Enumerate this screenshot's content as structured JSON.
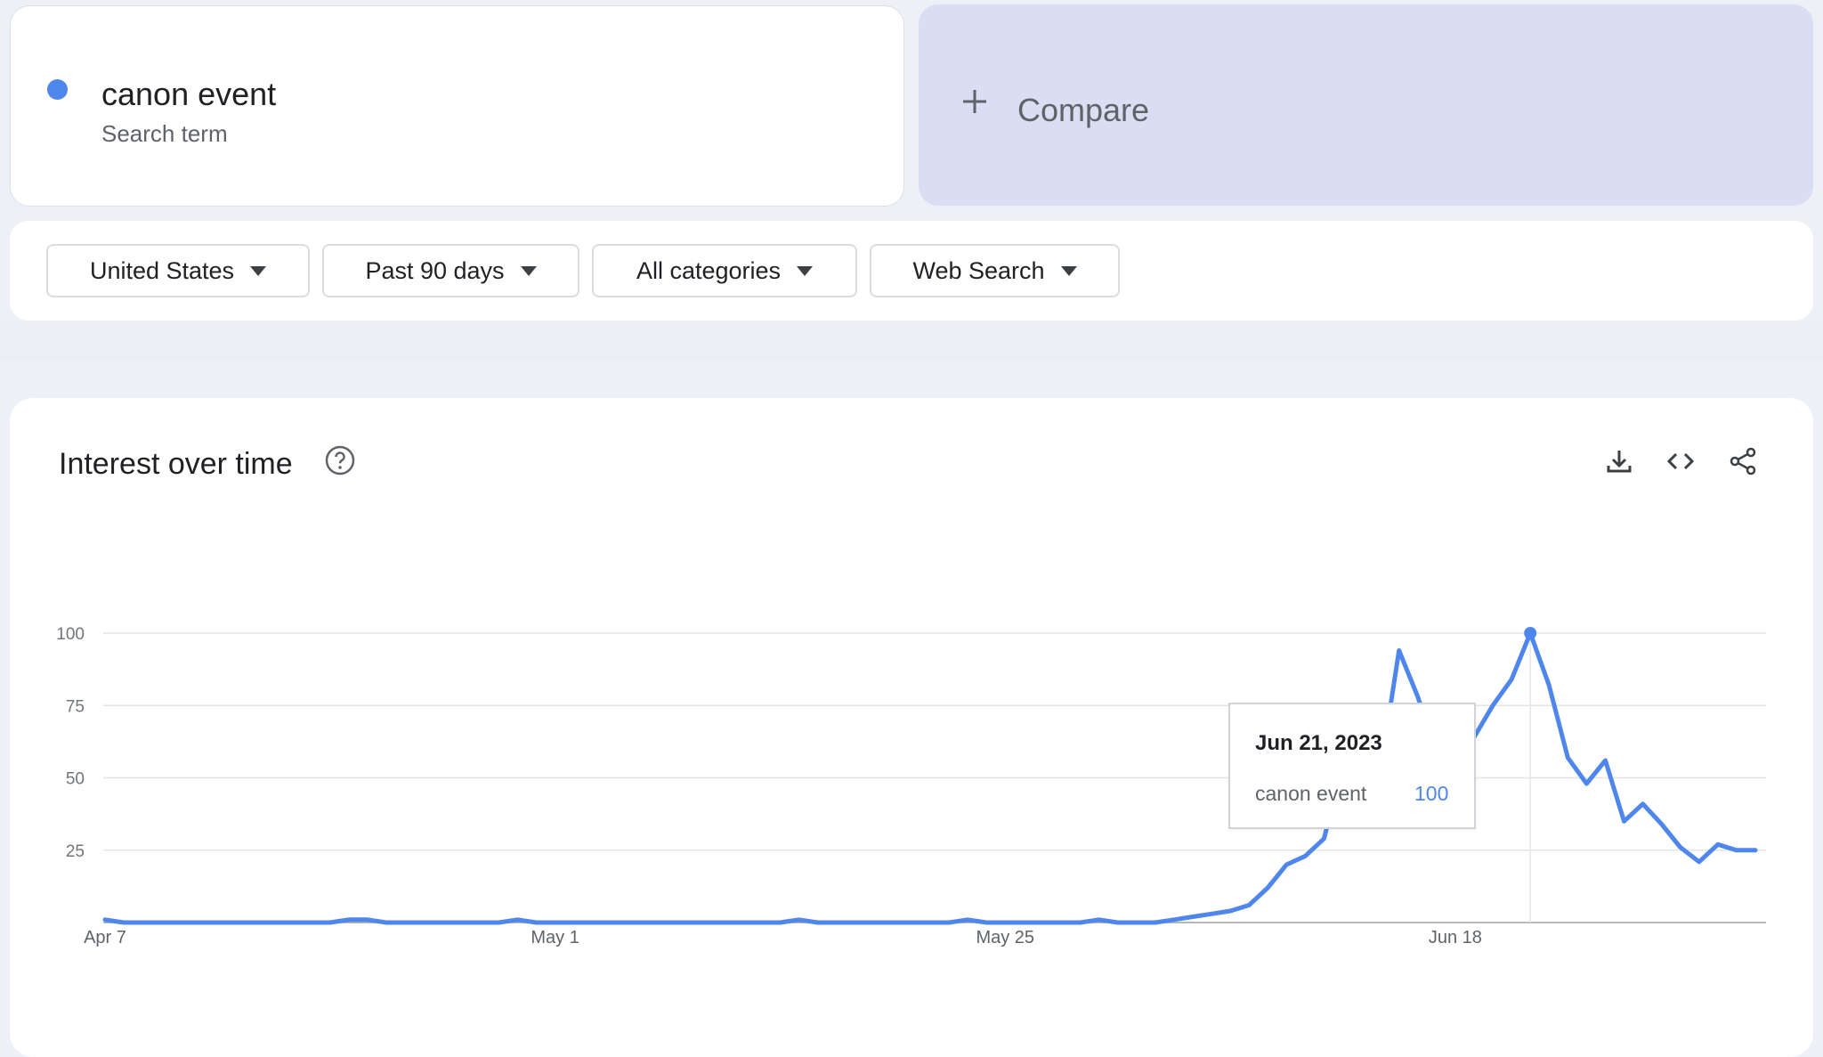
{
  "search_term": {
    "name": "canon event",
    "subtitle": "Search term",
    "color": "#4f86ec"
  },
  "compare": {
    "label": "Compare",
    "icon": "plus-icon"
  },
  "filters": [
    {
      "label": "United States",
      "icon": "caret-down-icon"
    },
    {
      "label": "Past 90 days",
      "icon": "caret-down-icon"
    },
    {
      "label": "All categories",
      "icon": "caret-down-icon"
    },
    {
      "label": "Web Search",
      "icon": "caret-down-icon"
    }
  ],
  "panel": {
    "title": "Interest over time",
    "help_icon": "help-icon",
    "tools": [
      "download-icon",
      "embed-code-icon",
      "share-icon"
    ]
  },
  "tooltip": {
    "date": "Jun 21, 2023",
    "series": "canon event",
    "value": "100"
  },
  "chart_data": {
    "type": "line",
    "x_ticks": [
      "Apr 7",
      "May 1",
      "May 25",
      "Jun 18"
    ],
    "y_ticks": [
      25,
      50,
      75,
      100
    ],
    "ylim": [
      0,
      100
    ],
    "grid": true,
    "series": [
      {
        "name": "canon event",
        "color": "#4f86ec",
        "start_date": "Apr 7",
        "values": [
          1,
          0,
          0,
          0,
          0,
          0,
          0,
          0,
          0,
          0,
          0,
          0,
          0,
          1,
          1,
          0,
          0,
          0,
          0,
          0,
          0,
          0,
          1,
          0,
          0,
          0,
          0,
          0,
          0,
          0,
          0,
          0,
          0,
          0,
          0,
          0,
          0,
          1,
          0,
          0,
          0,
          0,
          0,
          0,
          0,
          0,
          1,
          0,
          0,
          0,
          0,
          0,
          0,
          1,
          0,
          0,
          0,
          1,
          2,
          3,
          4,
          6,
          12,
          20,
          23,
          29,
          54,
          53,
          52,
          94,
          78,
          58,
          62,
          64,
          75,
          84,
          100,
          82,
          57,
          48,
          56,
          35,
          41,
          34,
          26,
          21,
          27,
          25,
          25
        ]
      }
    ],
    "highlight": {
      "date": "Jun 21, 2023",
      "value": 100
    }
  }
}
